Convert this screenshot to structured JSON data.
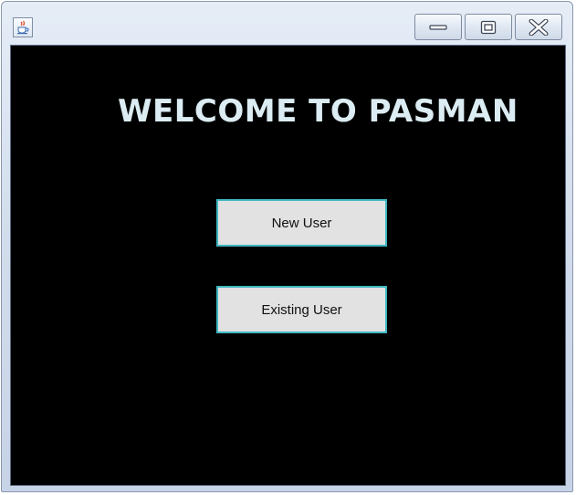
{
  "window": {
    "title": "",
    "icon": "java-cup-icon",
    "controls": {
      "minimize_icon": "minimize-icon",
      "maximize_icon": "maximize-icon",
      "close_icon": "close-icon"
    }
  },
  "main": {
    "heading": "WELCOME TO PASMAN",
    "buttons": {
      "new_user": "New User",
      "existing_user": "Existing User"
    }
  },
  "colors": {
    "background": "#000000",
    "heading": "#dcecf3",
    "button_face": "#e2e2e2",
    "button_border": "#3fb7c0"
  }
}
